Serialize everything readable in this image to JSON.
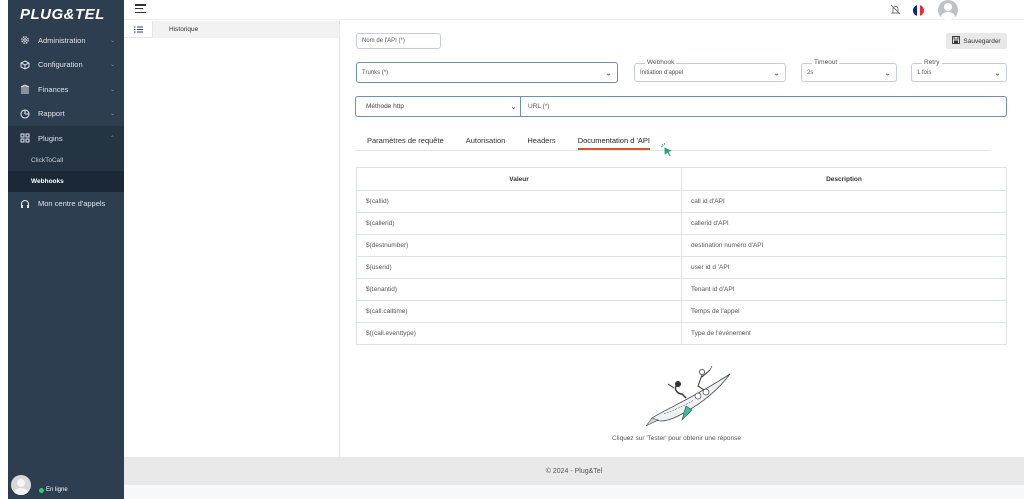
{
  "app": {
    "logo": "PLUG&TEL"
  },
  "sidebar": {
    "items": [
      {
        "label": "Administration",
        "icon": "gear-icon"
      },
      {
        "label": "Configuration",
        "icon": "cube-icon"
      },
      {
        "label": "Finances",
        "icon": "bank-icon"
      },
      {
        "label": "Rapport",
        "icon": "pie-chart-icon"
      },
      {
        "label": "Plugins",
        "icon": "grid-icon"
      }
    ],
    "plugins_sub": [
      "ClickToCall",
      "Webhooks"
    ],
    "call_center": "Mon centre d'appels",
    "status": "En ligne"
  },
  "list_panel": {
    "tab": "Historique"
  },
  "form": {
    "api_name": "Nom de l'API (*)",
    "trunks": "Trunks (*)",
    "webhook_legend": "Webhook",
    "webhook_value": "Initiation d'appel",
    "timeout_legend": "Timeout",
    "timeout_value": "2s",
    "retry_legend": "Retry",
    "retry_value": "1 fois",
    "save": "Sauvegarder",
    "method": "Méthode http",
    "url": "URL (*)"
  },
  "tabs": [
    "Paramètres de requête",
    "Autorisation",
    "Headers",
    "Documentation d 'API"
  ],
  "table": {
    "headers": [
      "Valeur",
      "Description"
    ],
    "rows": [
      [
        "$(callid)",
        "call id d'API"
      ],
      [
        "$(callerid)",
        "callerid d'API"
      ],
      [
        "$(destnumber)",
        "destination numéro d'API"
      ],
      [
        "$(userid)",
        "user id d 'API"
      ],
      [
        "$(tenantid)",
        "Tenant  id d'API"
      ],
      [
        "$(call.calltime)",
        "Temps de l'appel"
      ],
      [
        "$((call.eventtype)",
        "Type de l'événement"
      ]
    ]
  },
  "hint": "Cliquez sur 'Tester' pour obtenir une réponse",
  "footer": "© 2024 - Plug&Tel",
  "colors": {
    "sidebar": "#2c3e50",
    "accent": "#d4582a",
    "active_border": "#6c8fb9",
    "status": "#2ecc71"
  }
}
